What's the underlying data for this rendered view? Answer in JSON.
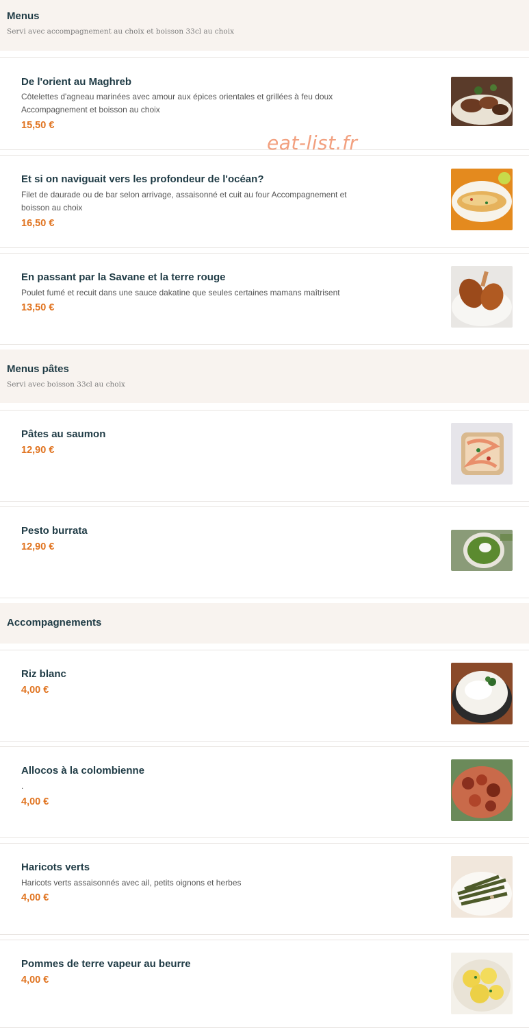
{
  "watermark": "eat-list.fr",
  "sections": {
    "menus": {
      "title": "Menus",
      "subtitle": "Servi avec accompagnement au choix et boisson 33cl au choix"
    },
    "menus_pates": {
      "title": "Menus pâtes",
      "subtitle": "Servi avec boisson 33cl au choix"
    },
    "accompagnements": {
      "title": "Accompagnements"
    }
  },
  "items": [
    {
      "title": "De l'orient au Maghreb",
      "desc_line1": "Côtelettes d'agneau marinées avec amour aux épices orientales et grillées à feu doux",
      "desc_line2": "Accompagnement et boisson au choix",
      "price": "15,50 €",
      "image_icon": "lamb-dish-photo"
    },
    {
      "title": "Et si on naviguait vers les profondeur de l'océan?",
      "desc_line1": "Filet de daurade ou de bar selon arrivage, assaisonné et cuit au four Accompagnement et",
      "desc_line2": "boisson au choix",
      "price": "16,50 €",
      "image_icon": "fish-dish-photo"
    },
    {
      "title": "En passant par la Savane et la terre rouge",
      "desc_line1": "Poulet fumé et recuit dans une sauce dakatine que seules certaines mamans maîtrisent",
      "price": "13,50 €",
      "image_icon": "chicken-dish-photo"
    },
    {
      "title": "Pâtes au saumon",
      "price": "12,90 €",
      "image_icon": "salmon-pasta-photo"
    },
    {
      "title": "Pesto burrata",
      "price": "12,90 €",
      "image_icon": "pesto-burrata-photo"
    },
    {
      "title": "Riz blanc",
      "price": "4,00 €",
      "image_icon": "white-rice-photo"
    },
    {
      "title": "Allocos à la colombienne",
      "desc_line1": ".",
      "price": "4,00 €",
      "image_icon": "plantain-photo"
    },
    {
      "title": "Haricots verts",
      "desc_line1": "Haricots verts assaisonnés avec ail, petits oignons et herbes",
      "price": "4,00 €",
      "image_icon": "green-beans-photo"
    },
    {
      "title": "Pommes de terre vapeur au beurre",
      "price": "4,00 €",
      "image_icon": "potatoes-photo"
    }
  ],
  "colors": {
    "section_bg": "#f8f3ef",
    "title": "#1f3b45",
    "price": "#e0731f",
    "watermark": "#f2a07f"
  }
}
